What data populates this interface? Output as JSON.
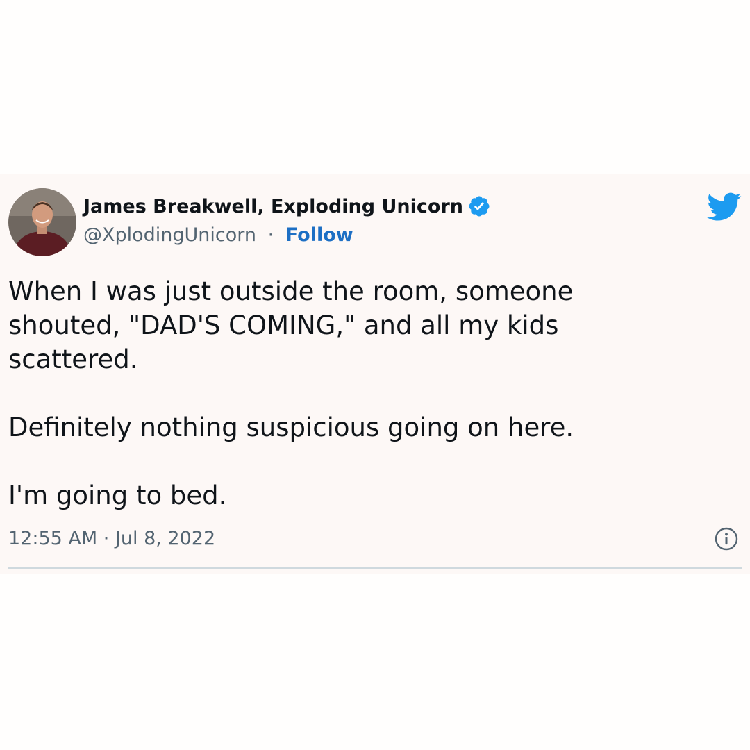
{
  "tweet": {
    "author": {
      "display_name": "James Breakwell, Exploding Unicorn",
      "handle": "@XplodingUnicorn",
      "verified": true,
      "avatar_icon": "profile-photo"
    },
    "separator": "·",
    "follow_label": "Follow",
    "paragraphs": [
      "When I was just outside the room, someone shouted, \"DAD'S COMING,\" and all my kids scattered.",
      "Definitely nothing suspicious going on here.",
      "I'm going to bed."
    ],
    "timestamp": "12:55 AM · Jul 8, 2022",
    "icons": {
      "brand": "twitter-bird-icon",
      "info": "info-icon",
      "verified": "verified-badge-icon"
    }
  },
  "colors": {
    "card_background": "#fdf8f6",
    "text_primary": "#0f1419",
    "text_secondary": "#536471",
    "follow_link": "#1d6fc4",
    "twitter_blue": "#1d9bf0",
    "divider": "#cfd9de"
  }
}
